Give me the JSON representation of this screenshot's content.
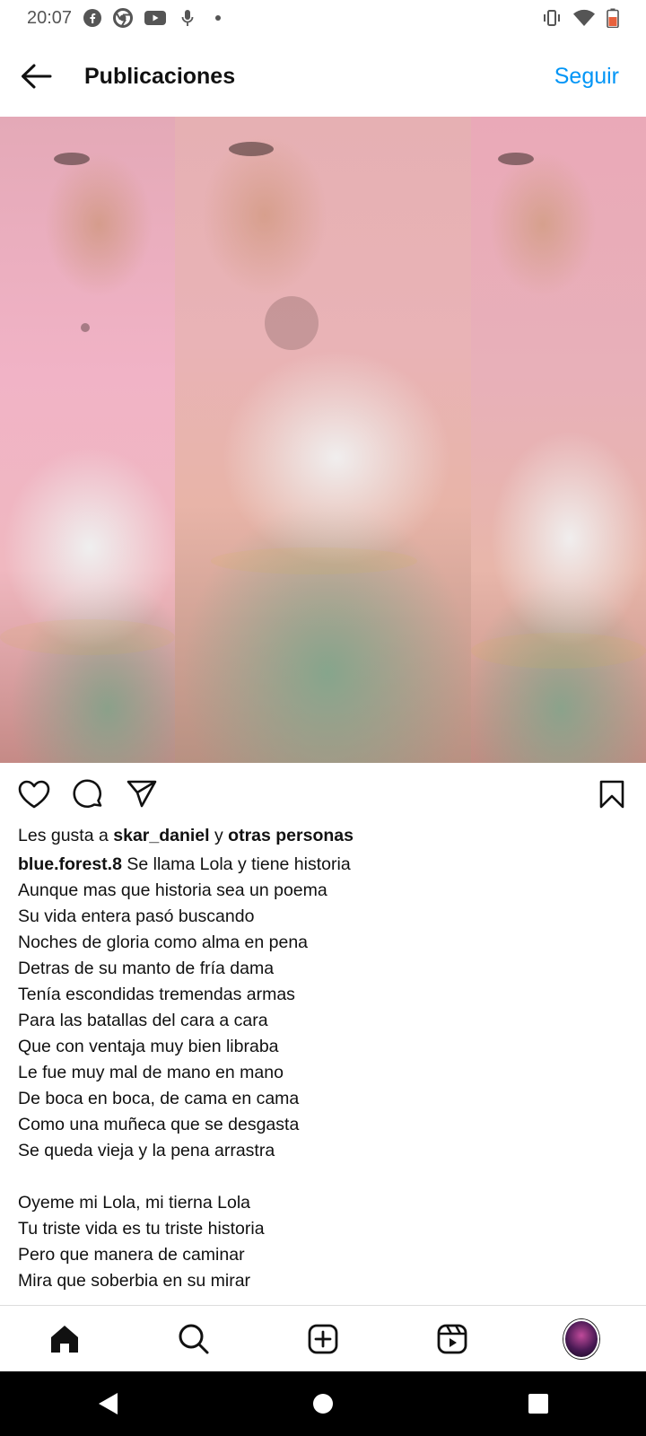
{
  "status_bar": {
    "time": "20:07",
    "icons": [
      "facebook-icon",
      "chrome-icon",
      "youtube-icon",
      "mic-icon",
      "dot-icon",
      "vibrate-icon",
      "wifi-icon",
      "battery-icon"
    ]
  },
  "header": {
    "title": "Publicaciones",
    "follow_label": "Seguir"
  },
  "colors": {
    "accent": "#0095f6",
    "text": "#111111"
  },
  "post": {
    "likes_prefix": "Les gusta a ",
    "likes_user": "skar_daniel",
    "likes_joiner": " y ",
    "likes_others": "otras personas",
    "author": "blue.forest.8",
    "caption": " Se llama Lola y tiene historia\nAunque mas que historia sea un poema\nSu vida entera pasó buscando\nNoches de gloria como alma en pena\nDetras de su manto de fría dama\nTenía escondidas tremendas armas\nPara las batallas del cara a cara\nQue con ventaja muy bien libraba\nLe fue muy mal de mano en mano\nDe boca en boca, de cama en cama\nComo una muñeca que se desgasta\nSe queda vieja y la pena arrastra\n\nOyeme mi Lola, mi tierna Lola\nTu triste vida es tu triste historia\nPero que manera de caminar\nMira que soberbia en su mirar"
  },
  "bottom_nav": [
    "home-icon",
    "search-icon",
    "new-post-icon",
    "reels-icon",
    "profile-avatar"
  ],
  "system_nav": [
    "back-icon",
    "home-circle-icon",
    "recents-icon"
  ]
}
